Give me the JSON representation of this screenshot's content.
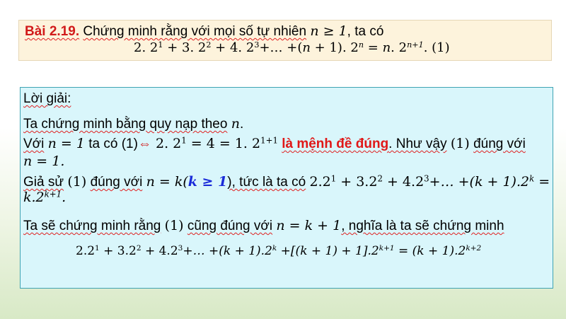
{
  "problem": {
    "label": "Bài 2.19.",
    "text": "Chứng minh rằng với mọi số tự nhiên",
    "cond": "n ≥ 1",
    "tail": ", ta có",
    "formula": {
      "t1": "2. 2",
      "e1": "1",
      "t2": " + 3. 2",
      "e2": "2",
      "t3": " + 4. 2",
      "e3": "3",
      "t4": "+… +(",
      "n1": "n",
      "t5": " + 1). 2",
      "e4": "n",
      "t6": " = ",
      "n2": "n",
      "t7": ". 2",
      "e5": "n+1",
      "t8": ". (1)"
    }
  },
  "solution": {
    "heading": "Lời giải:",
    "line1_text": "Ta chứng minh bằng quy nạp theo",
    "line1_var": "n",
    "line1_end": ".",
    "line2_a": "Với",
    "line2_math": "n = 1",
    "line2_b": "ta có (1)",
    "line2_arrow": "⇔",
    "line2_eq_a": " 2. 2",
    "line2_eq_e1": "1",
    "line2_eq_b": " = 4 = 1. 2",
    "line2_eq_e2": "1+1",
    "line2_red": "là mệnh đề đúng",
    "line2_c": ". Như vậy",
    "line2_one": "(1)",
    "line2_d": "đúng với",
    "line3": "n = 1.",
    "line4_a": "Giả sử",
    "line4_one": "(1)",
    "line4_b": "đúng với",
    "line4_math": "n = k(",
    "line4_blue": "k ≥ 1",
    "line4_c": "), tức là ta có",
    "line4_eq": "2.2",
    "line4_rest": {
      "e1": "1",
      "t2": " + 3.2",
      "e2": "2",
      "t3": " + 4.2",
      "e3": "3",
      "t4": "+… +(k + 1).2",
      "e4": "k",
      "t5": " ="
    },
    "line5_t": "k.2",
    "line5_e": "k+1",
    "line5_end": ".",
    "line6_a": "Ta sẽ chứng minh rằng",
    "line6_one": "(1)",
    "line6_b": "cũng đúng với",
    "line6_math": "n = k + 1",
    "line6_c": ", nghĩa là ta sẽ chứng minh",
    "line7": {
      "t1": "2.2",
      "e1": "1",
      "t2": " + 3.2",
      "e2": "2",
      "t3": " + 4.2",
      "e3": "3",
      "t4": "+… +(k + 1).2",
      "e4": "k",
      "t5": " +[(k + 1) + 1].2",
      "e5": "k+1",
      "t6": " = (k + 1).2",
      "e6": "k+2"
    }
  }
}
